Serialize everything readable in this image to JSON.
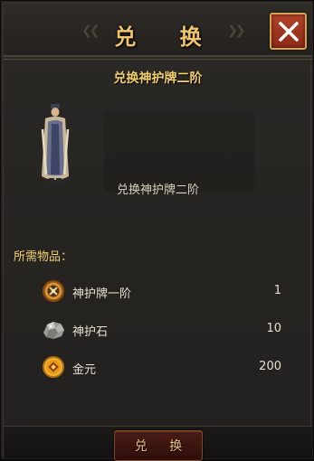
{
  "dialog": {
    "title": "兑  换",
    "close_icon": "close-x-icon",
    "colors": {
      "title": "#f0c46a",
      "close_button": "#a53923",
      "accent_gold": "#f3cf6c",
      "text": "#e6e0d2"
    }
  },
  "item": {
    "title": "兑换神护牌二阶",
    "preview_name": "兑换神护牌二阶",
    "preview_icon": "character-figure-icon"
  },
  "requirements": {
    "label": "所需物品：",
    "materials": [
      {
        "name": "神护牌一阶",
        "count": "1",
        "icon": "amulet-tier1-icon"
      },
      {
        "name": "神护石",
        "count": "10",
        "icon": "guardian-stone-icon"
      },
      {
        "name": "金元",
        "count": "200",
        "icon": "gold-coin-icon"
      }
    ]
  },
  "footer": {
    "exchange_label": "兑 换"
  }
}
